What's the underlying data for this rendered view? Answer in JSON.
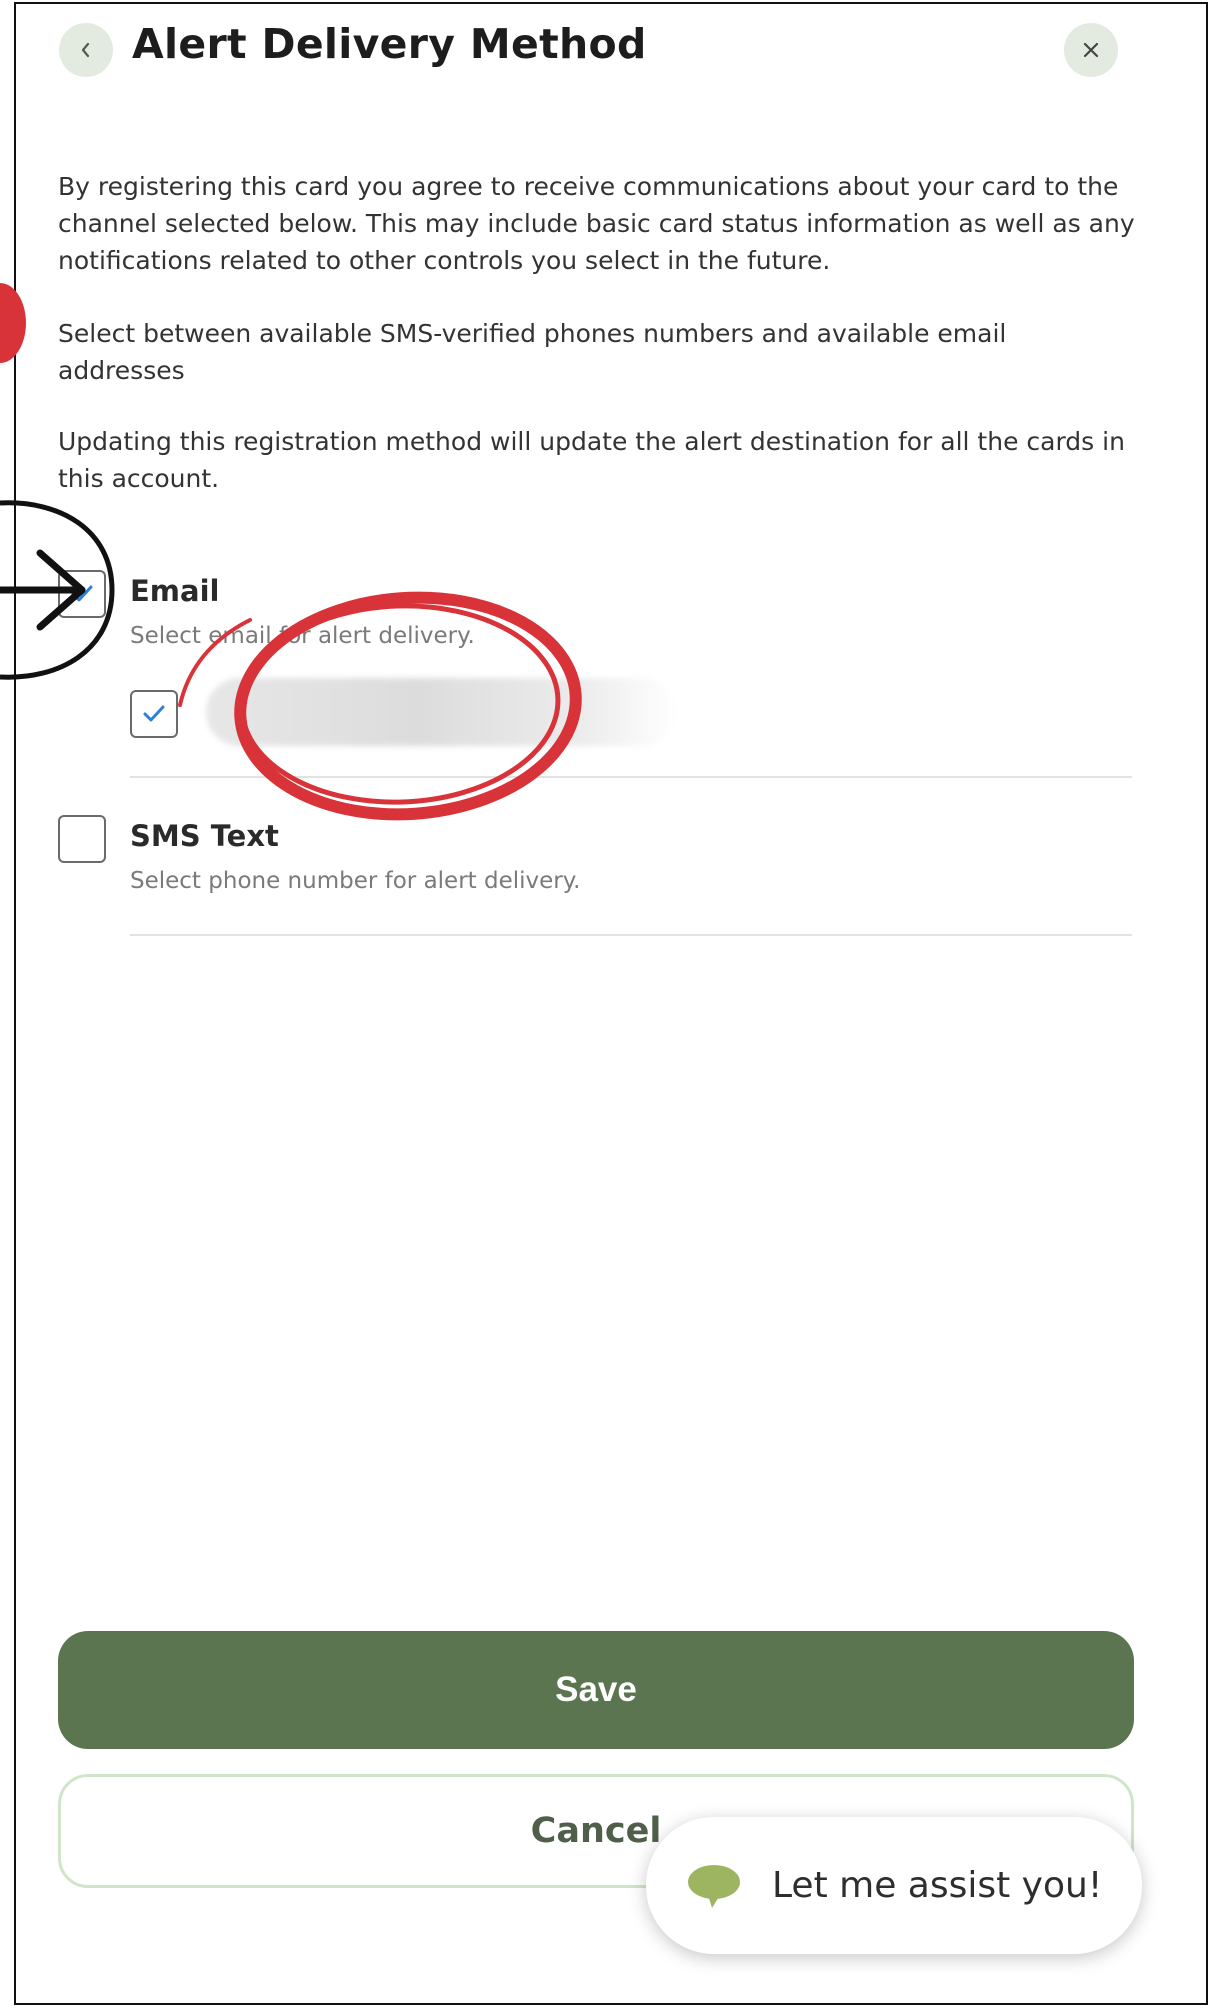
{
  "header": {
    "title": "Alert Delivery Method",
    "back_icon": "chevron-left-icon",
    "close_icon": "close-icon"
  },
  "body": {
    "paragraph_1": "By registering this card you agree to receive communications about your card to the channel selected below. This may include basic card status information as well as any notifications related to other controls you select in the future.",
    "paragraph_2": "Select between available SMS-verified phones numbers and available email addresses",
    "paragraph_3": "Updating this registration method will update the alert destination for all the cards in this account."
  },
  "options": {
    "email": {
      "label": "Email",
      "description": "Select email for alert delivery.",
      "checked": true,
      "address_checked": true
    },
    "sms": {
      "label": "SMS Text",
      "description": "Select phone number for alert delivery.",
      "checked": false
    }
  },
  "buttons": {
    "save_label": "Save",
    "cancel_label": "Cancel"
  },
  "assistant": {
    "label": "Let me assist you!",
    "icon": "chat-bubble-icon"
  },
  "colors": {
    "primary_green": "#5a7550",
    "light_green": "#cfe6c8",
    "check_blue": "#2f7fd6",
    "annotation_red": "#d9333a"
  }
}
